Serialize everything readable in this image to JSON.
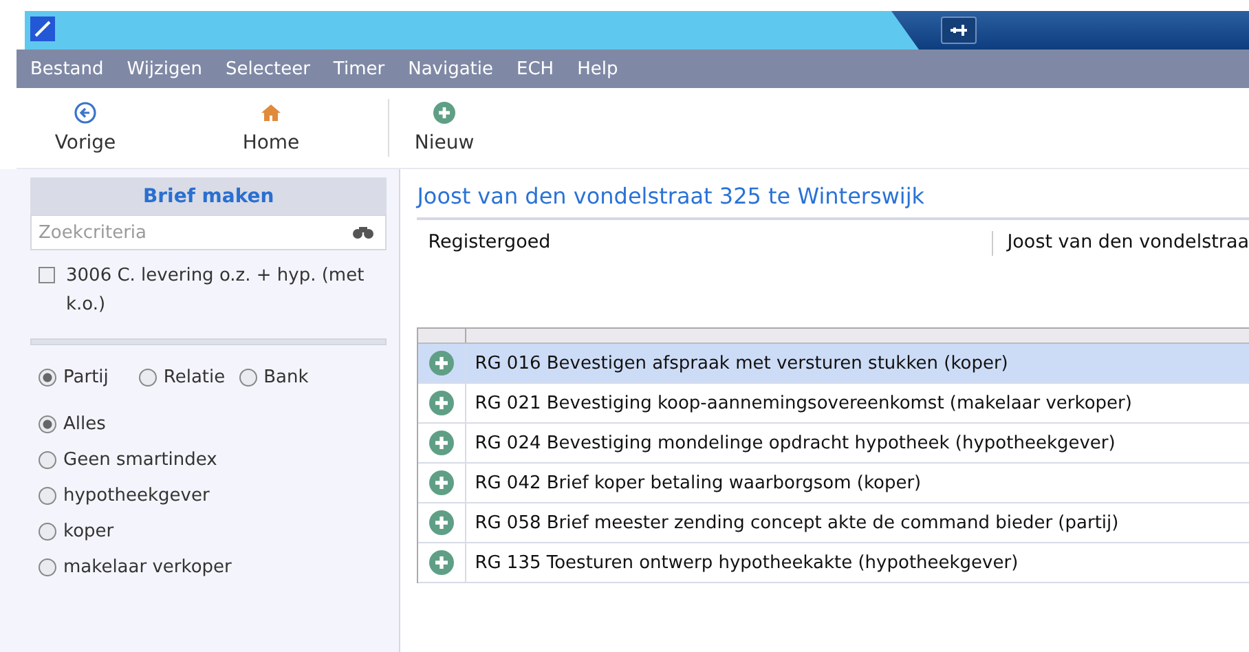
{
  "menu": [
    "Bestand",
    "Wijzigen",
    "Selecteer",
    "Timer",
    "Navigatie",
    "ECH",
    "Help"
  ],
  "toolbar": [
    {
      "label": "Vorige",
      "kind": "back"
    },
    {
      "label": "Home",
      "kind": "home"
    },
    {
      "label": "Nieuw",
      "kind": "new"
    }
  ],
  "sidebar": {
    "title": "Brief maken",
    "search": {
      "placeholder": "Zoekcriteria"
    },
    "checkbox": {
      "label": "3006 C. levering o.z. + hyp. (met k.o.)",
      "checked": false
    },
    "party_type": [
      {
        "label": "Partij",
        "selected": true
      },
      {
        "label": "Relatie",
        "selected": false
      },
      {
        "label": "Bank",
        "selected": false
      }
    ],
    "filters": [
      {
        "label": "Alles",
        "selected": true
      },
      {
        "label": "Geen smartindex",
        "selected": false
      },
      {
        "label": "hypotheekgever",
        "selected": false
      },
      {
        "label": "koper",
        "selected": false
      },
      {
        "label": "makelaar verkoper",
        "selected": false
      }
    ]
  },
  "main": {
    "title": "Joost van den vondelstraat 325 te Winterswijk",
    "info_label": "Registergoed",
    "info_value": "Joost van den vondelstraa",
    "rows": [
      {
        "text": "RG 016 Bevestigen afspraak met versturen stukken (koper)",
        "selected": true
      },
      {
        "text": "RG 021 Bevestiging koop-aannemingsovereenkomst (makelaar verkoper)",
        "selected": false
      },
      {
        "text": "RG 024 Bevestiging mondelinge opdracht hypotheek (hypotheekgever)",
        "selected": false
      },
      {
        "text": "RG 042 Brief koper betaling waarborgsom (koper)",
        "selected": false
      },
      {
        "text": "RG 058 Brief meester zending concept akte de command bieder (partij)",
        "selected": false
      },
      {
        "text": "RG 135 Toesturen ontwerp hypotheekakte (hypotheekgever)",
        "selected": false
      }
    ]
  }
}
